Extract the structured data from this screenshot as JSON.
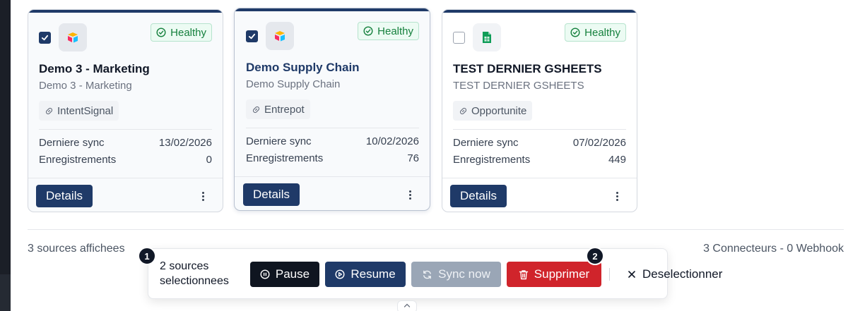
{
  "colors": {
    "navy": "#1f3a68",
    "danger": "#d0242b",
    "healthy": "#15803d",
    "dark": "#0f1520"
  },
  "cards": [
    {
      "selected": true,
      "icon": "airtable-icon",
      "status": "Healthy",
      "title": "Demo 3 - Marketing",
      "subtitle": "Demo 3 - Marketing",
      "tag": "IntentSignal",
      "last_sync_label": "Derniere sync",
      "last_sync": "13/02/2026",
      "records_label": "Enregistrements",
      "records": "0",
      "details_label": "Details"
    },
    {
      "selected": true,
      "icon": "airtable-icon",
      "status": "Healthy",
      "title": "Demo Supply Chain",
      "subtitle": "Demo Supply Chain",
      "tag": "Entrepot",
      "last_sync_label": "Derniere sync",
      "last_sync": "10/02/2026",
      "records_label": "Enregistrements",
      "records": "76",
      "details_label": "Details"
    },
    {
      "selected": false,
      "icon": "google-sheets-icon",
      "status": "Healthy",
      "title": "TEST DERNIER GSHEETS",
      "subtitle": "TEST DERNIER GSHEETS",
      "tag": "Opportunite",
      "last_sync_label": "Derniere sync",
      "last_sync": "07/02/2026",
      "records_label": "Enregistrements",
      "records": "449",
      "details_label": "Details"
    }
  ],
  "footer": {
    "left": "3 sources affichees",
    "right": "3 Connecteurs - 0 Webhook"
  },
  "bulk": {
    "count_line1": "2 sources",
    "count_line2": "selectionnees",
    "pause": "Pause",
    "resume": "Resume",
    "sync": "Sync now",
    "delete": "Supprimer",
    "deselect": "Deselectionner",
    "badge1": "1",
    "badge2": "2"
  }
}
